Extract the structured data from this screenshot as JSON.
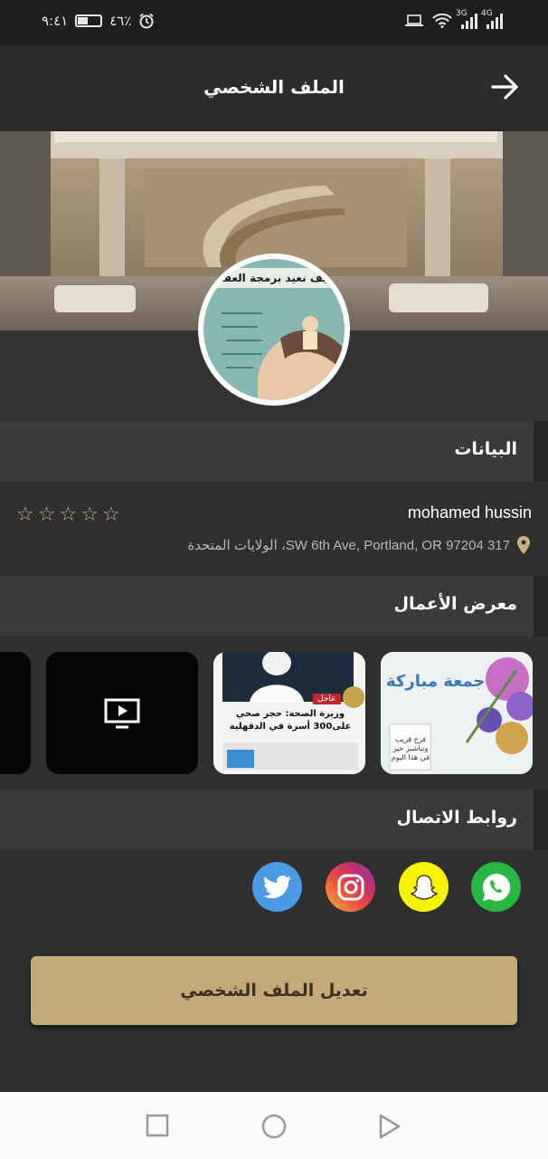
{
  "status_bar": {
    "time": "٩:٤١",
    "battery_percent": "٤٦٪",
    "battery_level": 0.46,
    "net1": "3G",
    "net2": "4G"
  },
  "header": {
    "title": "الملف الشخصي"
  },
  "avatar": {
    "caption": "كيف نعيد برمجة العقل"
  },
  "sections": {
    "info_title": "البيانات",
    "gallery_title": "معرض الأعمال",
    "contact_title": "روابط الاتصال"
  },
  "profile": {
    "name": "mohamed hussin",
    "address": "SW 6th Ave, Portland, OR 97204 317، الولايات المتحدة",
    "rating": 0,
    "rating_max": 5
  },
  "gallery": {
    "items": [
      {
        "type": "image",
        "text": "جمعة مباركة",
        "text2": "فرج قريب وتباشير خير في هذا اليوم"
      },
      {
        "type": "image",
        "badge": "عاجل",
        "headline": "وزيرة الصحة: حجر صحي على300 أسرة في الدقهلية"
      },
      {
        "type": "video"
      },
      {
        "type": "video"
      }
    ]
  },
  "contacts": [
    "whatsapp-icon",
    "snapchat-icon",
    "instagram-icon",
    "twitter-icon"
  ],
  "edit_button": {
    "label": "تعديل الملف الشخصي"
  },
  "colors": {
    "accent": "#c4aa78",
    "background": "#2f2f2f",
    "section_bg": "#3a3a3a"
  }
}
